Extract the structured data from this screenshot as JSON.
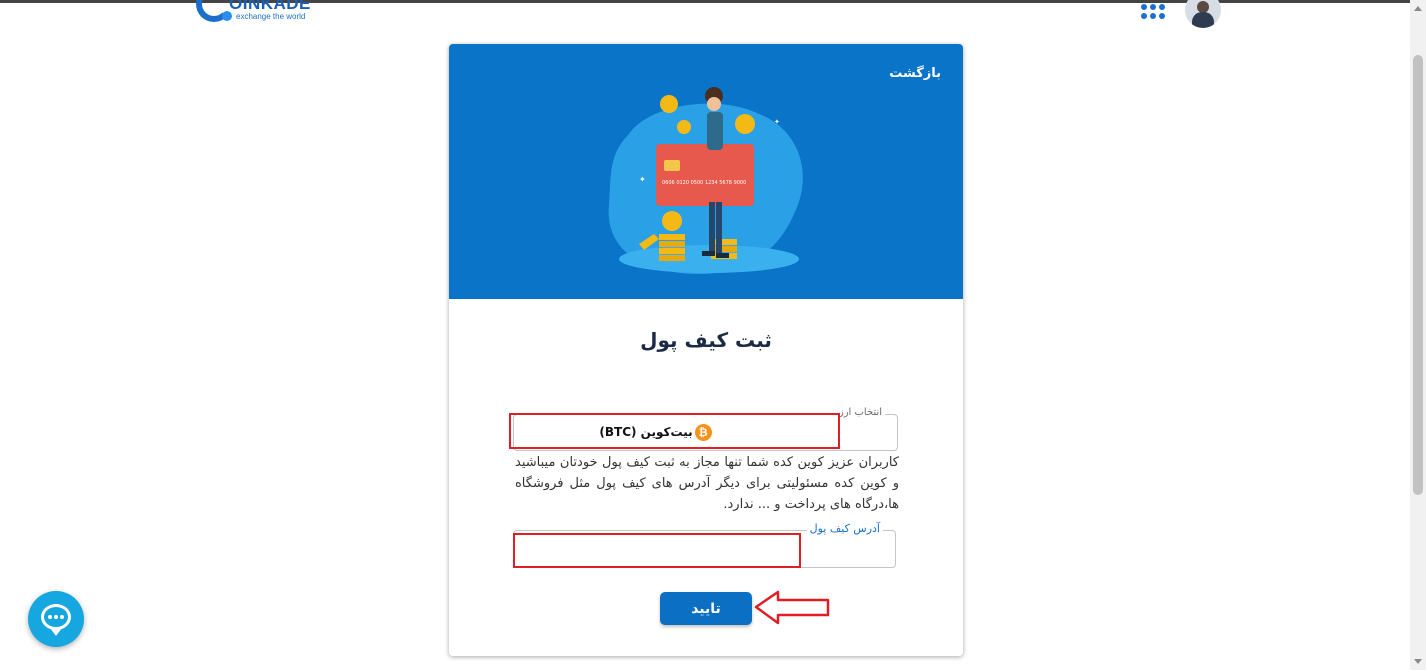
{
  "header": {
    "logo_name": "OINKADE",
    "logo_tagline": "exchange the world"
  },
  "card": {
    "back_label": "بازگشت",
    "title": "ثبت کیف پول",
    "currency_field": {
      "legend": "انتخاب ارز",
      "selected_value": "بیت‌کوین (BTC)",
      "selected_icon": "bitcoin-icon"
    },
    "note": "کاربران عزیز کوین کده شما تنها مجاز به ثبت کیف پول خودتان میباشید و کوین کده مسئولیتی برای دیگر آدرس های کیف پول مثل فروشگاه ها،درگاه های پرداخت و ... ندارد.",
    "wallet_field": {
      "legend": "آدرس کیف پول",
      "value": ""
    },
    "submit_label": "تایید",
    "illustration_card_number": "0606 0120 0500 1234 5678 9000"
  },
  "colors": {
    "primary": "#0b6fc4",
    "hero_bg": "#0a74c9",
    "annotation": "#e01e24",
    "chat": "#16a7e0",
    "bitcoin": "#f7931a"
  },
  "icons": [
    "apps-grid-icon",
    "avatar",
    "chat-icon",
    "bitcoin-icon",
    "arrow-annotation"
  ]
}
